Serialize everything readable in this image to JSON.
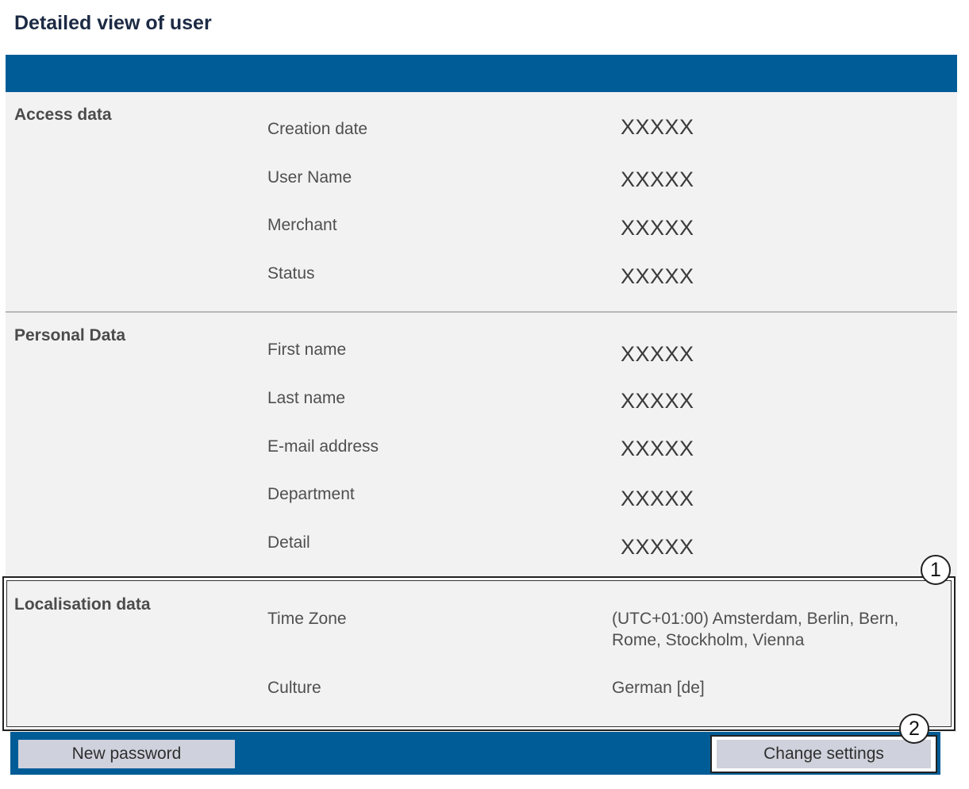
{
  "page": {
    "title": "Detailed view of user"
  },
  "sections": {
    "access": {
      "title": "Access data",
      "rows": [
        {
          "label": "Creation date",
          "value": "XXXXX"
        },
        {
          "label": "User Name",
          "value": "XXXXX"
        },
        {
          "label": "Merchant",
          "value": "XXXXX"
        },
        {
          "label": "Status",
          "value": "XXXXX"
        }
      ]
    },
    "personal": {
      "title": "Personal Data",
      "rows": [
        {
          "label": "First name",
          "value": "XXXXX"
        },
        {
          "label": "Last name",
          "value": "XXXXX"
        },
        {
          "label": "E-mail address",
          "value": "XXXXX"
        },
        {
          "label": "Department",
          "value": "XXXXX"
        },
        {
          "label": "Detail",
          "value": "XXXXX"
        }
      ]
    },
    "localisation": {
      "title": "Localisation data",
      "rows": [
        {
          "label": "Time Zone",
          "value_line1": "(UTC+01:00) Amsterdam, Berlin, Bern,",
          "value_line2": "Rome, Stockholm, Vienna"
        },
        {
          "label": "Culture",
          "value": "German [de]"
        }
      ]
    }
  },
  "buttons": {
    "new_password": "New password",
    "change_settings": "Change settings"
  },
  "callouts": [
    "1",
    "2"
  ],
  "colors": {
    "brand_blue": "#005c97",
    "panel_bg": "#f2f2f2",
    "button_bg": "#cfd1dc"
  }
}
